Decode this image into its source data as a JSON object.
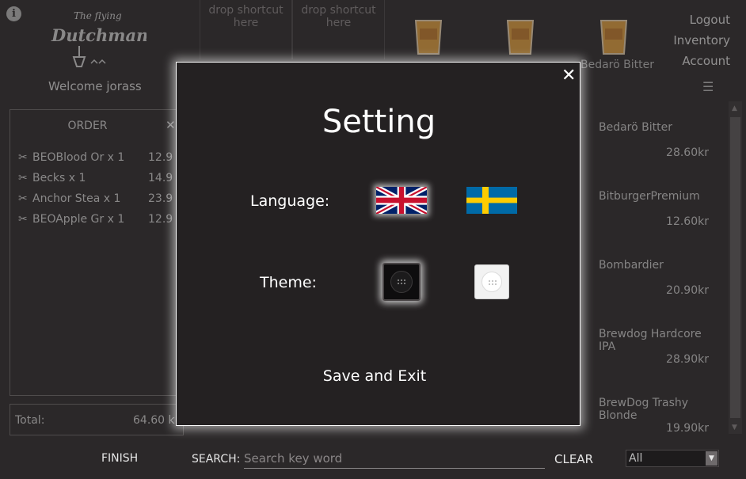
{
  "app": {
    "welcome": "Welcome jorass",
    "logo_text": [
      "The flying",
      "Dutchman"
    ]
  },
  "shortcut_slots": [
    "drop shortcut here",
    "drop shortcut here"
  ],
  "top_beer_name": "Bedarö Bitter",
  "header_links": {
    "logout": "Logout",
    "inventory": "Inventory",
    "account": "Account"
  },
  "order": {
    "title": "ORDER",
    "close": "✕",
    "rows": [
      {
        "name": "BEOBlood Or x 1",
        "price": "12.9"
      },
      {
        "name": "Becks x 1",
        "price": "14.9"
      },
      {
        "name": "Anchor Stea x 1",
        "price": "23.9"
      },
      {
        "name": "BEOApple Gr x 1",
        "price": "12.9"
      }
    ],
    "total_label": "Total:",
    "total_value": "64.60 k"
  },
  "beers": [
    {
      "name": "Bedarö Bitter",
      "price": "28.60kr"
    },
    {
      "name": "BitburgerPremium",
      "price": "12.60kr"
    },
    {
      "name": "Bombardier",
      "price": "20.90kr"
    },
    {
      "name": "Brewdog Hardcore IPA",
      "price": "28.90kr"
    },
    {
      "name": "BrewDog Trashy Blonde",
      "price": "19.90kr"
    }
  ],
  "bottom_bar": {
    "finish": "FINISH",
    "search_label": "SEARCH:",
    "search_placeholder": "Search key word",
    "clear": "CLEAR",
    "filter_value": "All"
  },
  "modal": {
    "title": "Setting",
    "close": "✕",
    "language_label": "Language:",
    "theme_label": "Theme:",
    "save_exit": "Save and Exit",
    "selected_language": "english",
    "selected_theme": "dark"
  },
  "colors": {
    "background": "#2b2829",
    "modal_bg": "#242122",
    "accent_glass": "#e8a33c"
  }
}
